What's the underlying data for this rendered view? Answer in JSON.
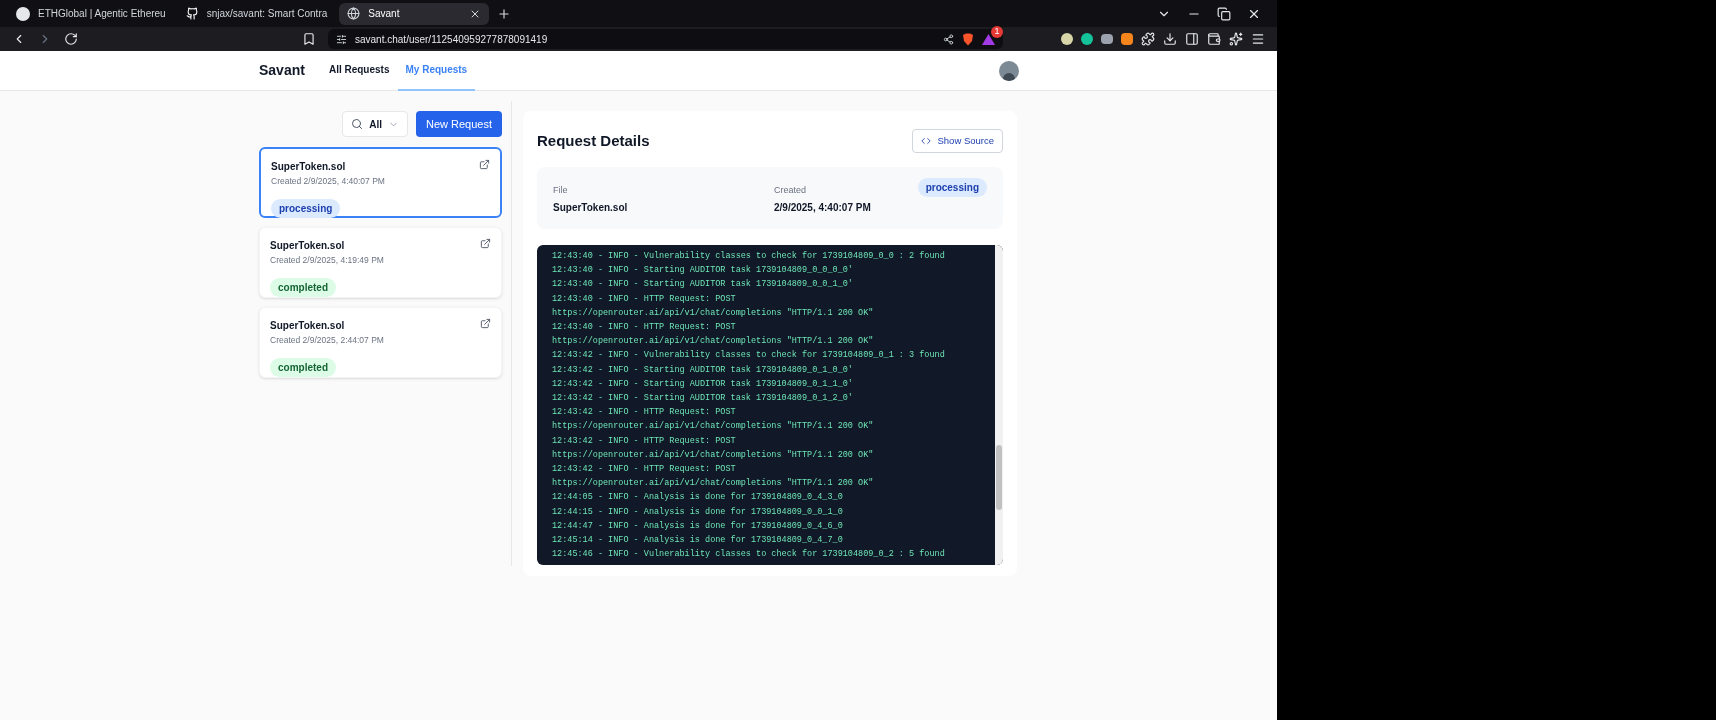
{
  "browser": {
    "tabs": [
      {
        "title": "ETHGlobal | Agentic Ethereu",
        "kind": "ethglobal",
        "selected": false
      },
      {
        "title": "snjax/savant: Smart Contra",
        "kind": "github",
        "selected": false
      },
      {
        "title": "Savant",
        "kind": "globe",
        "selected": true
      }
    ],
    "url": "savant.chat/user/112540959277878091419",
    "rewards_badge": "1"
  },
  "nav": {
    "brand": "Savant",
    "links": [
      {
        "label": "All Requests",
        "selected": false
      },
      {
        "label": "My Requests",
        "selected": true
      }
    ]
  },
  "filter": {
    "value": "All"
  },
  "new_request_button": "New Request",
  "requests": [
    {
      "file": "SuperToken.sol",
      "created": "Created 2/9/2025, 4:40:07 PM",
      "status": "processing",
      "selected": true
    },
    {
      "file": "SuperToken.sol",
      "created": "Created 2/9/2025, 4:19:49 PM",
      "status": "completed",
      "selected": false
    },
    {
      "file": "SuperToken.sol",
      "created": "Created 2/9/2025, 2:44:07 PM",
      "status": "completed",
      "selected": false
    }
  ],
  "details": {
    "title": "Request Details",
    "source_button": "Show Source",
    "file_label": "File",
    "file": "SuperToken.sol",
    "created_label": "Created",
    "created": "2/9/2025, 4:40:07 PM",
    "status": "processing",
    "log": [
      "12:43:40 - INFO - Vulnerability classes to check for 1739104809_0_0 : 2 found",
      "12:43:40 - INFO - Starting AUDITOR task 1739104809_0_0_0_0'",
      "12:43:40 - INFO - Starting AUDITOR task 1739104809_0_0_1_0'",
      "12:43:40 - INFO - HTTP Request: POST",
      "https://openrouter.ai/api/v1/chat/completions \"HTTP/1.1 200 OK\"",
      "12:43:40 - INFO - HTTP Request: POST",
      "https://openrouter.ai/api/v1/chat/completions \"HTTP/1.1 200 OK\"",
      "12:43:42 - INFO - Vulnerability classes to check for 1739104809_0_1 : 3 found",
      "12:43:42 - INFO - Starting AUDITOR task 1739104809_0_1_0_0'",
      "12:43:42 - INFO - Starting AUDITOR task 1739104809_0_1_1_0'",
      "12:43:42 - INFO - Starting AUDITOR task 1739104809_0_1_2_0'",
      "12:43:42 - INFO - HTTP Request: POST",
      "https://openrouter.ai/api/v1/chat/completions \"HTTP/1.1 200 OK\"",
      "12:43:42 - INFO - HTTP Request: POST",
      "https://openrouter.ai/api/v1/chat/completions \"HTTP/1.1 200 OK\"",
      "12:43:42 - INFO - HTTP Request: POST",
      "https://openrouter.ai/api/v1/chat/completions \"HTTP/1.1 200 OK\"",
      "12:44:05 - INFO - Analysis is done for 1739104809_0_4_3_0",
      "12:44:15 - INFO - Analysis is done for 1739104809_0_0_1_0",
      "12:44:47 - INFO - Analysis is done for 1739104809_0_4_6_0",
      "12:45:14 - INFO - Analysis is done for 1739104809_0_4_7_0",
      "12:45:46 - INFO - Vulnerability classes to check for 1739104809_0_2 : 5 found"
    ]
  }
}
